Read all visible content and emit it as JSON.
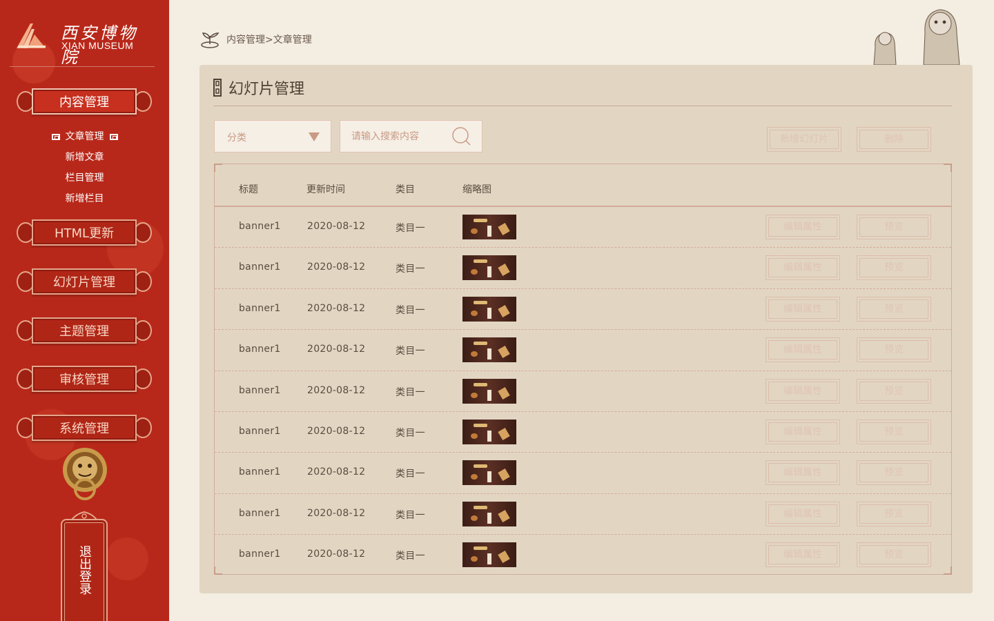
{
  "brand": {
    "name_cn": "西安博物院",
    "name_en": "XIAN MUSEUM"
  },
  "nav": {
    "items": [
      {
        "label": "内容管理",
        "active": true
      },
      {
        "label": "HTML更新",
        "active": false
      },
      {
        "label": "幻灯片管理",
        "active": false
      },
      {
        "label": "主题管理",
        "active": false
      },
      {
        "label": "审核管理",
        "active": false
      },
      {
        "label": "系统管理",
        "active": false
      }
    ],
    "subitems": [
      {
        "label": "文章管理",
        "active": true
      },
      {
        "label": "新增文章",
        "active": false
      },
      {
        "label": "栏目管理",
        "active": false
      },
      {
        "label": "新增栏目",
        "active": false
      }
    ],
    "logout_label": "退出登录"
  },
  "breadcrumb": {
    "path": "内容管理>文章管理"
  },
  "panel": {
    "title": "幻灯片管理",
    "filter": {
      "category_label": "分类",
      "search_placeholder": "请输入搜索内容"
    },
    "actions": {
      "add_label": "新增幻灯片",
      "delete_label": "删除"
    },
    "table": {
      "columns": [
        "标题",
        "更新时间",
        "类目",
        "缩略图"
      ],
      "row_actions": {
        "edit_label": "编辑属性",
        "preview_label": "预览"
      },
      "rows": [
        {
          "title": "banner1",
          "updated": "2020-08-12",
          "category": "类目一"
        },
        {
          "title": "banner1",
          "updated": "2020-08-12",
          "category": "类目一"
        },
        {
          "title": "banner1",
          "updated": "2020-08-12",
          "category": "类目一"
        },
        {
          "title": "banner1",
          "updated": "2020-08-12",
          "category": "类目一"
        },
        {
          "title": "banner1",
          "updated": "2020-08-12",
          "category": "类目一"
        },
        {
          "title": "banner1",
          "updated": "2020-08-12",
          "category": "类目一"
        },
        {
          "title": "banner1",
          "updated": "2020-08-12",
          "category": "类目一"
        },
        {
          "title": "banner1",
          "updated": "2020-08-12",
          "category": "类目一"
        },
        {
          "title": "banner1",
          "updated": "2020-08-12",
          "category": "类目一"
        }
      ]
    }
  },
  "colors": {
    "sidebar_red": "#b8281a",
    "panel_bg": "#e2d6c3",
    "page_bg": "#f3ede2",
    "accent_border": "#d2ab9a"
  },
  "icons": {
    "breadcrumb": "sprout-icon",
    "title": "fret-pattern-icon",
    "search": "search-icon",
    "dropdown": "caret-down-icon"
  }
}
